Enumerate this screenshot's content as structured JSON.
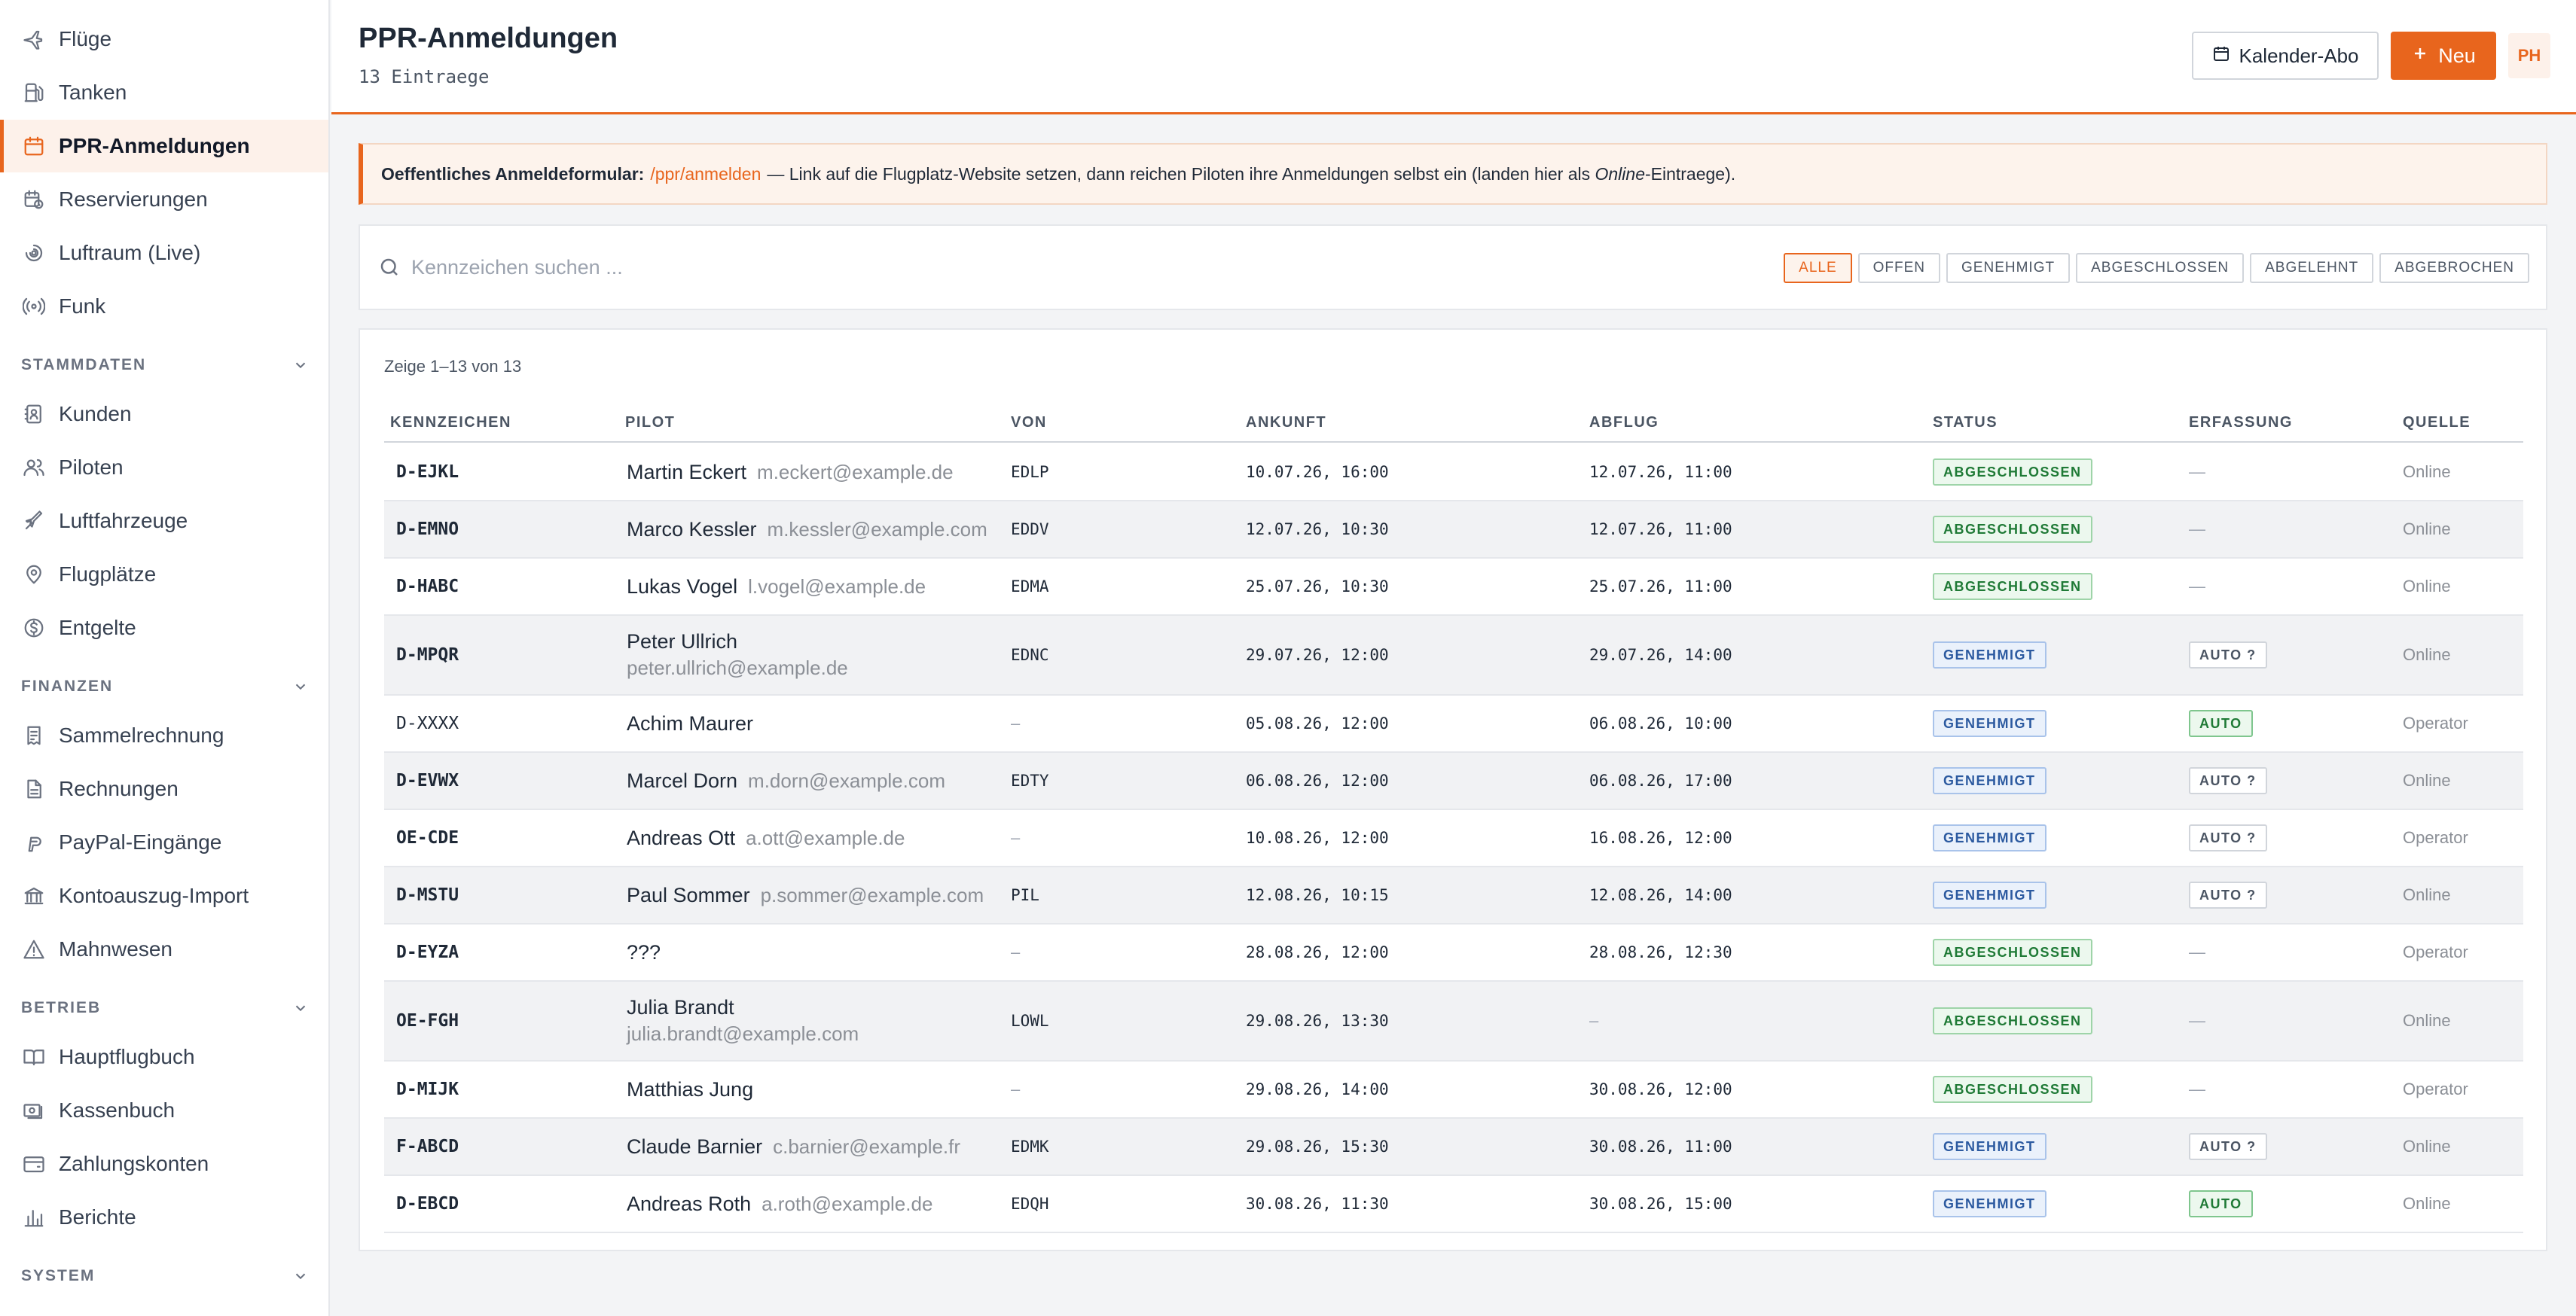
{
  "nav": {
    "top_items": [
      {
        "label": "Flüge",
        "icon": "plane-icon"
      },
      {
        "label": "Tanken",
        "icon": "fuel-icon"
      },
      {
        "label": "PPR-Anmeldungen",
        "icon": "calendar-icon",
        "active": true
      },
      {
        "label": "Reservierungen",
        "icon": "calendar-clock-icon"
      },
      {
        "label": "Luftraum (Live)",
        "icon": "radar-icon"
      },
      {
        "label": "Funk",
        "icon": "radio-icon"
      }
    ],
    "sections": [
      {
        "title": "STAMMDATEN",
        "items": [
          {
            "label": "Kunden",
            "icon": "contacts-icon"
          },
          {
            "label": "Piloten",
            "icon": "users-icon"
          },
          {
            "label": "Luftfahrzeuge",
            "icon": "aircraft-icon"
          },
          {
            "label": "Flugplätze",
            "icon": "map-pin-icon"
          },
          {
            "label": "Entgelte",
            "icon": "currency-icon"
          }
        ]
      },
      {
        "title": "FINANZEN",
        "items": [
          {
            "label": "Sammelrechnung",
            "icon": "receipt-icon"
          },
          {
            "label": "Rechnungen",
            "icon": "document-icon"
          },
          {
            "label": "PayPal-Eingänge",
            "icon": "paypal-icon"
          },
          {
            "label": "Kontoauszug-Import",
            "icon": "bank-icon"
          },
          {
            "label": "Mahnwesen",
            "icon": "warning-icon"
          }
        ]
      },
      {
        "title": "BETRIEB",
        "items": [
          {
            "label": "Hauptflugbuch",
            "icon": "book-icon"
          },
          {
            "label": "Kassenbuch",
            "icon": "cash-icon"
          },
          {
            "label": "Zahlungskonten",
            "icon": "wallet-icon"
          },
          {
            "label": "Berichte",
            "icon": "bar-chart-icon"
          }
        ]
      },
      {
        "title": "SYSTEM",
        "items": []
      }
    ]
  },
  "header": {
    "title": "PPR-Anmeldungen",
    "subtitle": "13 Eintraege",
    "calendar_button": "Kalender-Abo",
    "new_button": "Neu",
    "avatar_initials": "PH"
  },
  "banner": {
    "bold": "Oeffentliches Anmeldeformular:",
    "link": "/ppr/anmelden",
    "text_before": "— Link auf die Flugplatz-Website setzen, dann reichen Piloten ihre Anmeldungen selbst ein (landen hier als",
    "italic": "Online",
    "text_after": "-Eintraege)."
  },
  "search": {
    "placeholder": "Kennzeichen suchen ...",
    "value": ""
  },
  "filters": [
    {
      "label": "ALLE",
      "active": true
    },
    {
      "label": "OFFEN"
    },
    {
      "label": "GENEHMIGT"
    },
    {
      "label": "ABGESCHLOSSEN"
    },
    {
      "label": "ABGELEHNT"
    },
    {
      "label": "ABGEBROCHEN"
    }
  ],
  "table": {
    "count_text": "Zeige 1–13 von 13",
    "columns": [
      "KENNZEICHEN",
      "PILOT",
      "VON",
      "ANKUNFT",
      "ABFLUG",
      "STATUS",
      "ERFASSUNG",
      "QUELLE"
    ],
    "rows": [
      {
        "kz": "D-EJKL",
        "pilot": "Martin Eckert",
        "email": "m.eckert@example.de",
        "stack": false,
        "von": "EDLP",
        "ankunft": "10.07.26, 16:00",
        "abflug": "12.07.26, 11:00",
        "status": "ABGESCHLOSSEN",
        "status_type": "done",
        "erfassung": "—",
        "erf_type": "none",
        "quelle": "Online"
      },
      {
        "kz": "D-EMNO",
        "pilot": "Marco Kessler",
        "email": "m.kessler@example.com",
        "stack": false,
        "von": "EDDV",
        "ankunft": "12.07.26, 10:30",
        "abflug": "12.07.26, 11:00",
        "status": "ABGESCHLOSSEN",
        "status_type": "done",
        "erfassung": "—",
        "erf_type": "none",
        "quelle": "Online"
      },
      {
        "kz": "D-HABC",
        "pilot": "Lukas Vogel",
        "email": "l.vogel@example.de",
        "stack": false,
        "von": "EDMA",
        "ankunft": "25.07.26, 10:30",
        "abflug": "25.07.26, 11:00",
        "status": "ABGESCHLOSSEN",
        "status_type": "done",
        "erfassung": "—",
        "erf_type": "none",
        "quelle": "Online"
      },
      {
        "kz": "D-MPQR",
        "pilot": "Peter Ullrich",
        "email": "peter.ullrich@example.de",
        "stack": true,
        "von": "EDNC",
        "ankunft": "29.07.26, 12:00",
        "abflug": "29.07.26, 14:00",
        "status": "GENEHMIGT",
        "status_type": "ok",
        "erfassung": "AUTO ?",
        "erf_type": "autoq",
        "quelle": "Online"
      },
      {
        "kz": "D-XXXX",
        "pilot": "Achim Maurer",
        "email": "",
        "stack": false,
        "von": "–",
        "ankunft": "05.08.26, 12:00",
        "abflug": "06.08.26, 10:00",
        "status": "GENEHMIGT",
        "status_type": "ok",
        "erfassung": "AUTO",
        "erf_type": "auto",
        "quelle": "Operator"
      },
      {
        "kz": "D-EVWX",
        "pilot": "Marcel Dorn",
        "email": "m.dorn@example.com",
        "stack": false,
        "von": "EDTY",
        "ankunft": "06.08.26, 12:00",
        "abflug": "06.08.26, 17:00",
        "status": "GENEHMIGT",
        "status_type": "ok",
        "erfassung": "AUTO ?",
        "erf_type": "autoq",
        "quelle": "Online"
      },
      {
        "kz": "OE-CDE",
        "pilot": "Andreas Ott",
        "email": "a.ott@example.de",
        "stack": false,
        "von": "–",
        "ankunft": "10.08.26, 12:00",
        "abflug": "16.08.26, 12:00",
        "status": "GENEHMIGT",
        "status_type": "ok",
        "erfassung": "AUTO ?",
        "erf_type": "autoq",
        "quelle": "Operator"
      },
      {
        "kz": "D-MSTU",
        "pilot": "Paul Sommer",
        "email": "p.sommer@example.com",
        "stack": false,
        "von": "PIL",
        "ankunft": "12.08.26, 10:15",
        "abflug": "12.08.26, 14:00",
        "status": "GENEHMIGT",
        "status_type": "ok",
        "erfassung": "AUTO ?",
        "erf_type": "autoq",
        "quelle": "Online"
      },
      {
        "kz": "D-EYZA",
        "pilot": "???",
        "email": "",
        "stack": false,
        "von": "–",
        "ankunft": "28.08.26, 12:00",
        "abflug": "28.08.26, 12:30",
        "status": "ABGESCHLOSSEN",
        "status_type": "done",
        "erfassung": "—",
        "erf_type": "none",
        "quelle": "Operator"
      },
      {
        "kz": "OE-FGH",
        "pilot": "Julia Brandt",
        "email": "julia.brandt@example.com",
        "stack": true,
        "von": "LOWL",
        "ankunft": "29.08.26, 13:30",
        "abflug": "–",
        "status": "ABGESCHLOSSEN",
        "status_type": "done",
        "erfassung": "—",
        "erf_type": "none",
        "quelle": "Online"
      },
      {
        "kz": "D-MIJK",
        "pilot": "Matthias Jung",
        "email": "",
        "stack": false,
        "von": "–",
        "ankunft": "29.08.26, 14:00",
        "abflug": "30.08.26, 12:00",
        "status": "ABGESCHLOSSEN",
        "status_type": "done",
        "erfassung": "—",
        "erf_type": "none",
        "quelle": "Operator"
      },
      {
        "kz": "F-ABCD",
        "pilot": "Claude Barnier",
        "email": "c.barnier@example.fr",
        "stack": false,
        "von": "EDMK",
        "ankunft": "29.08.26, 15:30",
        "abflug": "30.08.26, 11:00",
        "status": "GENEHMIGT",
        "status_type": "ok",
        "erfassung": "AUTO ?",
        "erf_type": "autoq",
        "quelle": "Online"
      },
      {
        "kz": "D-EBCD",
        "pilot": "Andreas Roth",
        "email": "a.roth@example.de",
        "stack": false,
        "von": "EDQH",
        "ankunft": "30.08.26, 11:30",
        "abflug": "30.08.26, 15:00",
        "status": "GENEHMIGT",
        "status_type": "ok",
        "erfassung": "AUTO",
        "erf_type": "auto",
        "quelle": "Online"
      }
    ]
  },
  "colors": {
    "accent": "#e8651d",
    "status_done": "#1f7a36",
    "status_approved": "#2c5aa0"
  }
}
